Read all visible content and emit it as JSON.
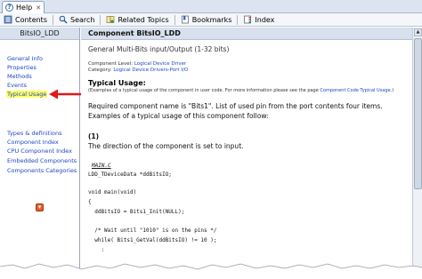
{
  "window": {
    "tab_label": "Help",
    "close_glyph": "✕"
  },
  "toolbar": {
    "items": [
      {
        "label": "Contents",
        "icon": "contents-icon"
      },
      {
        "label": "Search",
        "icon": "search-icon"
      },
      {
        "label": "Related Topics",
        "icon": "related-topics-icon"
      },
      {
        "label": "Bookmarks",
        "icon": "bookmarks-icon"
      },
      {
        "label": "Index",
        "icon": "index-icon"
      }
    ]
  },
  "leftnav": {
    "title": "BitsIO_LDD",
    "links": [
      {
        "label": "General Info"
      },
      {
        "label": "Properties"
      },
      {
        "label": "Methods"
      },
      {
        "label": "Events"
      },
      {
        "label": "Typical Usage",
        "active": true
      },
      {
        "label": "Types & definitions"
      },
      {
        "label": "Component Index"
      },
      {
        "label": "CPU Component Index"
      },
      {
        "label": "Embedded Components"
      },
      {
        "label": "Components Categories"
      }
    ]
  },
  "content": {
    "title": "Component BitsIO_LDD",
    "subtitle": "General Multi-Bits input/Output (1-32 bits)",
    "component_level_label": "Component Level:",
    "component_level_value": "Logical Device Driver",
    "category_label": "Category:",
    "category_value": "Logical Device Drivers-Port I/O",
    "section_heading": "Typical Usage:",
    "examples_prefix": "(Examples of a typical usage of the component in user code. For more information please see the page",
    "examples_link": "Component Code Typical Usage",
    "examples_suffix": ".)",
    "para_line1": "Required component name is \"Bits1\". List of used pin from the port contents four items.",
    "para_line2": "Examples of a typical usage of this component follow:",
    "example_number": "(1)",
    "example_desc": "The direction of the component is set to input.",
    "code_file": "MAIN.C",
    "code_lines": [
      "LDD_TDeviceData *ddBitsIO;",
      "",
      "void main(void)",
      "{",
      "  ddBitsIO = Bits1_Init(NULL);",
      "",
      "  /* Wait until \"1010\" is on the pins */",
      "  while( Bits1_GetVal(ddBitsIO) != 10 );",
      "    :"
    ]
  },
  "colors": {
    "link": "#1f46c4",
    "highlight": "#ffff66",
    "arrow": "#e01818",
    "header_bg": "#d7e0ec"
  }
}
